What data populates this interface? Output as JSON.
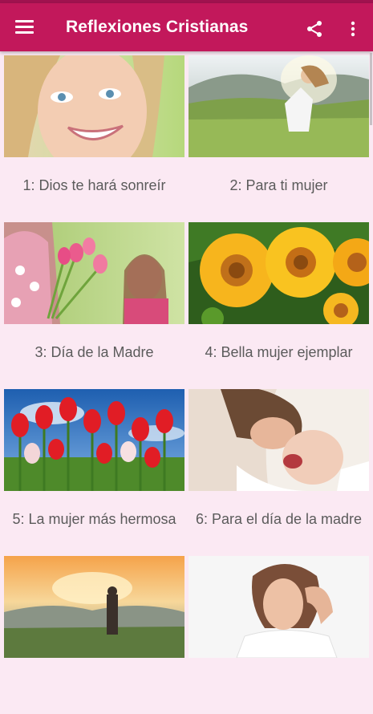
{
  "appbar": {
    "title": "Reflexiones Cristianas",
    "menu_icon": "hamburger-menu-icon",
    "share_icon": "share-icon",
    "more_icon": "more-vert-icon",
    "color": "#c2185b"
  },
  "items": [
    {
      "label": "1: Dios te hará sonreír",
      "image": "smiling-woman-photo"
    },
    {
      "label": "2: Para ti mujer",
      "image": "woman-in-field-photo"
    },
    {
      "label": "3: Día de la Madre",
      "image": "mother-daughter-tulips-photo"
    },
    {
      "label": "4: Bella mujer ejemplar",
      "image": "yellow-flowers-photo"
    },
    {
      "label": "5: La mujer más hermosa",
      "image": "red-tulips-photo"
    },
    {
      "label": "6: Para el día de la madre",
      "image": "mother-baby-photo"
    },
    {
      "label": "",
      "image": "sunset-mountain-photo"
    },
    {
      "label": "",
      "image": "thoughtful-woman-photo"
    }
  ]
}
